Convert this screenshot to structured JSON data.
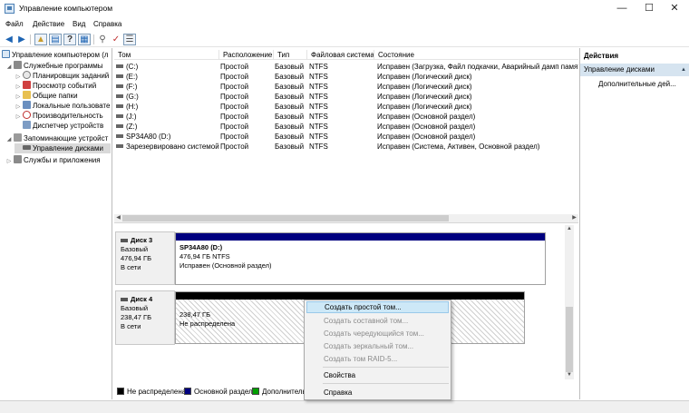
{
  "window": {
    "title": "Управление компьютером",
    "min": "—",
    "max": "☐",
    "close": "✕"
  },
  "menu": [
    "Файл",
    "Действие",
    "Вид",
    "Справка"
  ],
  "toolbar": [
    "back",
    "forward",
    "up",
    "properties",
    "help",
    "toggle-tree",
    "delete",
    "check",
    "properties-2"
  ],
  "tree": {
    "root": "Управление компьютером (л",
    "nodes": [
      {
        "label": "Служебные программы",
        "level": 1,
        "expanded": true
      },
      {
        "label": "Планировщик заданий",
        "level": 2
      },
      {
        "label": "Просмотр событий",
        "level": 2
      },
      {
        "label": "Общие папки",
        "level": 2
      },
      {
        "label": "Локальные пользовате",
        "level": 2
      },
      {
        "label": "Производительность",
        "level": 2
      },
      {
        "label": "Диспетчер устройств",
        "level": 2
      },
      {
        "label": "Запоминающие устройст",
        "level": 1,
        "expanded": true
      },
      {
        "label": "Управление дисками",
        "level": 2,
        "selected": true
      },
      {
        "label": "Службы и приложения",
        "level": 1
      }
    ]
  },
  "volumes": {
    "headers": [
      "Том",
      "Расположение",
      "Тип",
      "Файловая система",
      "Состояние"
    ],
    "rows": [
      [
        "(C:)",
        "Простой",
        "Базовый",
        "NTFS",
        "Исправен (Загрузка, Файл подкачки, Аварийный дамп памяти"
      ],
      [
        "(E:)",
        "Простой",
        "Базовый",
        "NTFS",
        "Исправен (Логический диск)"
      ],
      [
        "(F:)",
        "Простой",
        "Базовый",
        "NTFS",
        "Исправен (Логический диск)"
      ],
      [
        "(G:)",
        "Простой",
        "Базовый",
        "NTFS",
        "Исправен (Логический диск)"
      ],
      [
        "(H:)",
        "Простой",
        "Базовый",
        "NTFS",
        "Исправен (Логический диск)"
      ],
      [
        "(J:)",
        "Простой",
        "Базовый",
        "NTFS",
        "Исправен (Основной раздел)"
      ],
      [
        "(Z:)",
        "Простой",
        "Базовый",
        "NTFS",
        "Исправен (Основной раздел)"
      ],
      [
        "SP34A80 (D:)",
        "Простой",
        "Базовый",
        "NTFS",
        "Исправен (Основной раздел)"
      ],
      [
        "Зарезервировано системой",
        "Простой",
        "Базовый",
        "NTFS",
        "Исправен (Система, Активен, Основной раздел)"
      ]
    ]
  },
  "disks": [
    {
      "name": "Диск 3",
      "type": "Базовый",
      "size": "476,94 ГБ",
      "status": "В сети",
      "partition": {
        "label": "SP34A80 (D:)",
        "detail": "476,94 ГБ NTFS",
        "state": "Исправен (Основной раздел)",
        "bar_color": "#00007f"
      }
    },
    {
      "name": "Диск 4",
      "type": "Базовый",
      "size": "238,47 ГБ",
      "status": "В сети",
      "partition": {
        "label": "",
        "detail": "238,47 ГБ",
        "state": "Не распределена",
        "bar_color": "#000000"
      }
    }
  ],
  "legend": [
    {
      "label": "Не распределена",
      "color": "#000000"
    },
    {
      "label": "Основной раздел",
      "color": "#00007f"
    },
    {
      "label": "Дополнитель",
      "color": "#00a000"
    }
  ],
  "actions": {
    "title": "Действия",
    "section": "Управление дисками",
    "more": "Дополнительные дей..."
  },
  "context_menu": {
    "items": [
      {
        "label": "Создать простой том...",
        "state": "highlighted"
      },
      {
        "label": "Создать составной том...",
        "state": "disabled"
      },
      {
        "label": "Создать чередующийся том...",
        "state": "disabled"
      },
      {
        "label": "Создать зеркальный том...",
        "state": "disabled"
      },
      {
        "label": "Создать том RAID-5...",
        "state": "disabled"
      },
      {
        "label": "Свойства",
        "state": "normal"
      },
      {
        "label": "Справка",
        "state": "normal"
      }
    ]
  },
  "colors": {
    "accent": "#cde8f7",
    "selection": "#d6e4f0",
    "primary_partition": "#00007f"
  }
}
